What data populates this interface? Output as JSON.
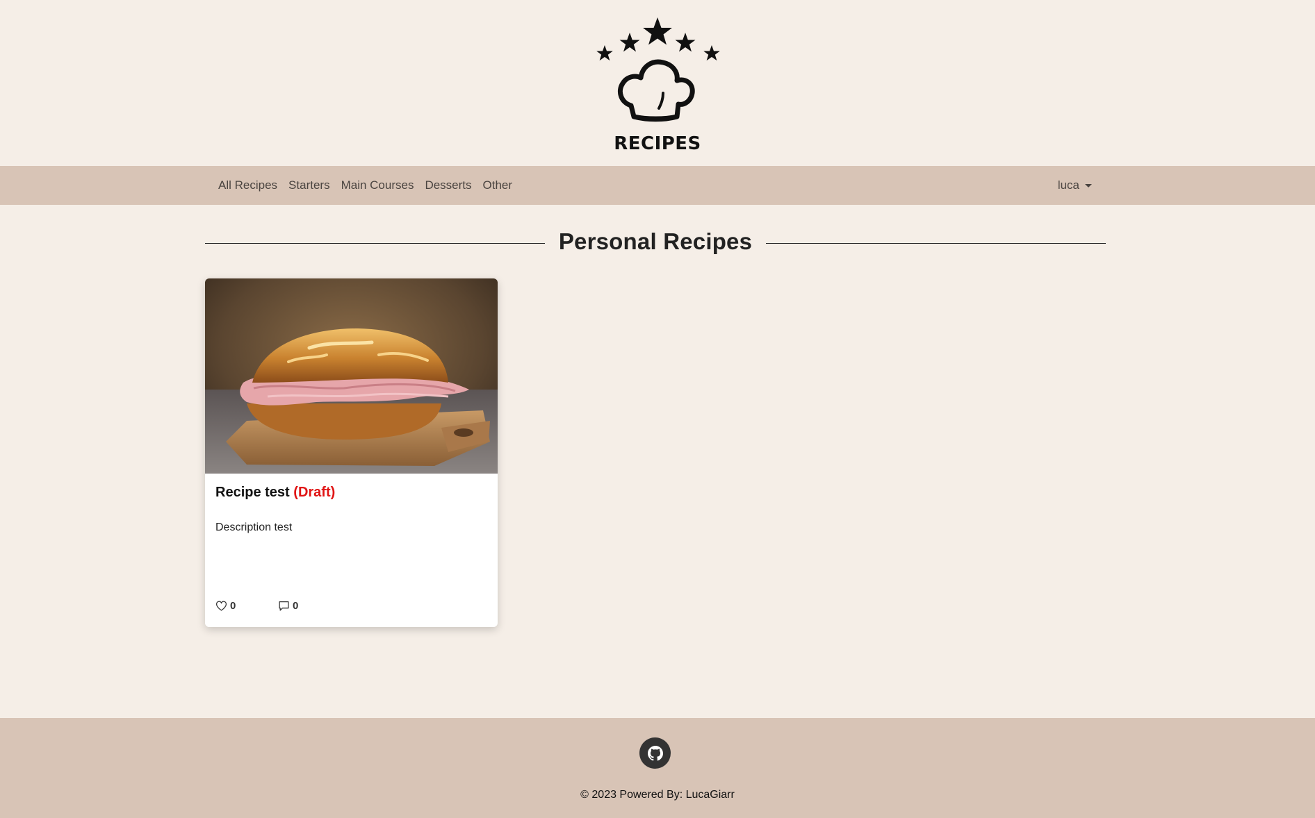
{
  "header": {
    "logo_text": "RECIPES"
  },
  "nav": {
    "items": [
      {
        "label": "All Recipes"
      },
      {
        "label": "Starters"
      },
      {
        "label": "Main Courses"
      },
      {
        "label": "Desserts"
      },
      {
        "label": "Other"
      }
    ],
    "user": "luca"
  },
  "main": {
    "section_title": "Personal Recipes",
    "recipes": [
      {
        "title": "Recipe test",
        "status": "(Draft)",
        "description": "Description test",
        "likes": "0",
        "comments": "0"
      }
    ]
  },
  "footer": {
    "copyright": "© 2023 Powered By: LucaGiarr"
  },
  "colors": {
    "page_bg": "#f5eee7",
    "nav_bg": "#d8c4b6",
    "draft": "#e01414"
  }
}
